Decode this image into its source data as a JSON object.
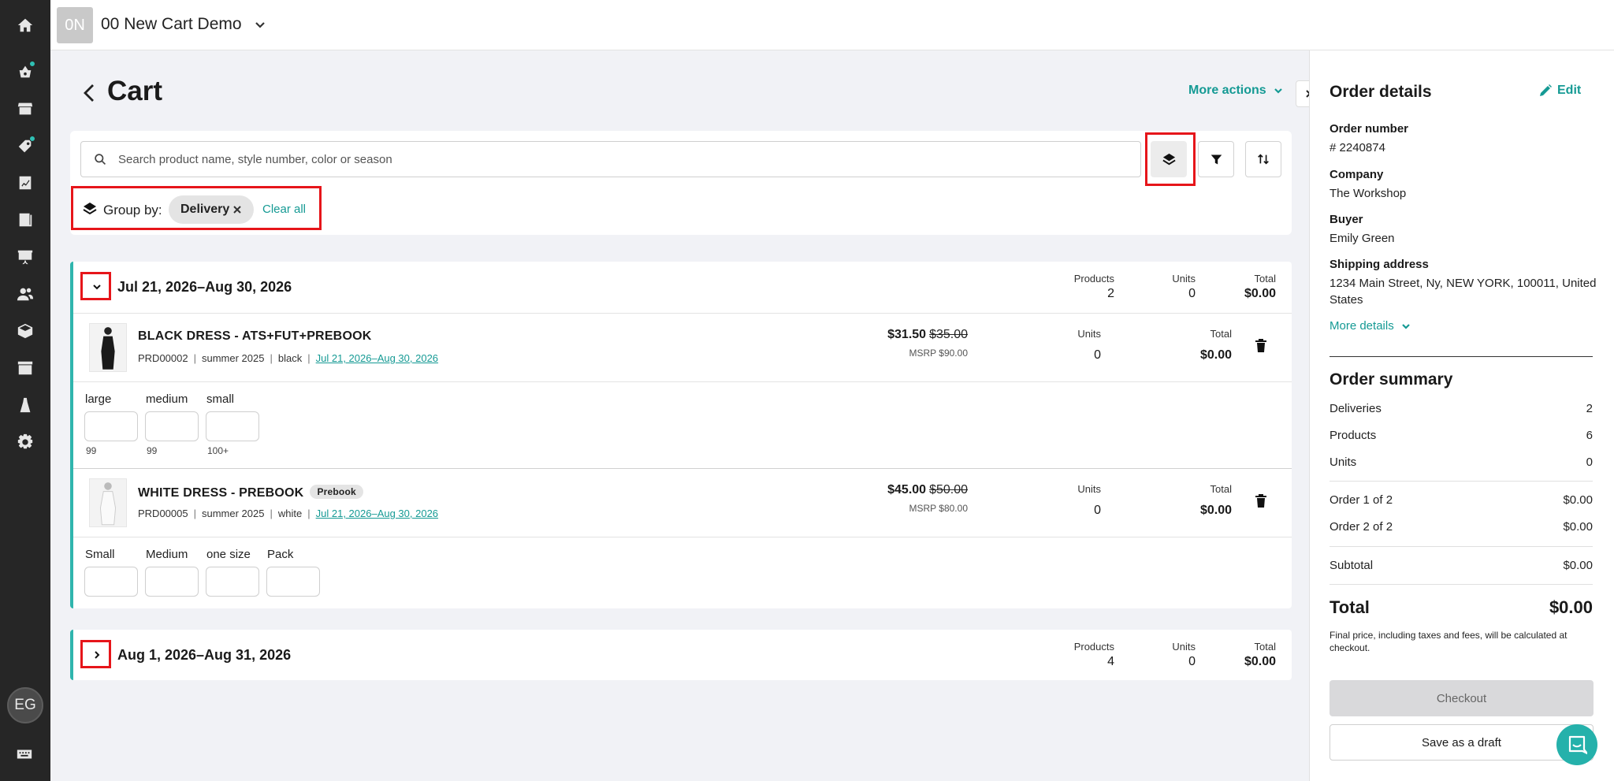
{
  "colors": {
    "accent": "#159a94",
    "sidebar": "#262626",
    "highlight": "#e6151a",
    "group_border": "#2fb5ad"
  },
  "sidebar": {
    "icons": [
      "home-icon",
      "basket-icon",
      "storefront-icon",
      "tag-icon",
      "analytics-icon",
      "catalog-icon",
      "presentation-icon",
      "users-icon",
      "box-icon",
      "shop-icon",
      "brand-icon",
      "gear-icon"
    ],
    "avatar": "EG",
    "bottom_icon": "keyboard-icon"
  },
  "topbar": {
    "workspace_badge": "0N",
    "workspace_name": "00 New Cart Demo"
  },
  "page": {
    "title": "Cart",
    "more_actions": "More actions"
  },
  "toolbar": {
    "search_placeholder": "Search product name, style number, color or season",
    "group_by_label": "Group by:",
    "group_by_chip": "Delivery",
    "clear_all": "Clear all"
  },
  "groups": [
    {
      "title": "Jul 21, 2026–Aug 30, 2026",
      "expanded": true,
      "stats": {
        "products_label": "Products",
        "products": "2",
        "units_label": "Units",
        "units": "0",
        "total_label": "Total",
        "total": "$0.00"
      },
      "products": [
        {
          "name": "BLACK DRESS - ATS+FUT+PREBOOK",
          "code": "PRD00002",
          "season": "summer 2025",
          "color": "black",
          "delivery": "Jul 21, 2026–Aug 30, 2026",
          "price": "$31.50",
          "old_price": "$35.00",
          "msrp": "MSRP $90.00",
          "units_label": "Units",
          "units": "0",
          "total_label": "Total",
          "total": "$0.00",
          "sizes": [
            {
              "label": "large",
              "stock": "99"
            },
            {
              "label": "medium",
              "stock": "99"
            },
            {
              "label": "small",
              "stock": "100+"
            }
          ]
        },
        {
          "name": "WHITE DRESS - PREBOOK",
          "badge": "Prebook",
          "code": "PRD00005",
          "season": "summer 2025",
          "color": "white",
          "delivery": "Jul 21, 2026–Aug 30, 2026",
          "price": "$45.00",
          "old_price": "$50.00",
          "msrp": "MSRP $80.00",
          "units_label": "Units",
          "units": "0",
          "total_label": "Total",
          "total": "$0.00",
          "sizes": [
            {
              "label": "Small"
            },
            {
              "label": "Medium"
            },
            {
              "label": "one size"
            },
            {
              "label": "Pack"
            }
          ]
        }
      ]
    },
    {
      "title": "Aug 1, 2026–Aug 31, 2026",
      "expanded": false,
      "stats": {
        "products_label": "Products",
        "products": "4",
        "units_label": "Units",
        "units": "0",
        "total_label": "Total",
        "total": "$0.00"
      }
    }
  ],
  "order_details": {
    "title": "Order details",
    "edit": "Edit",
    "order_number_label": "Order number",
    "order_number": "# 2240874",
    "company_label": "Company",
    "company": "The Workshop",
    "buyer_label": "Buyer",
    "buyer": "Emily Green",
    "shipping_label": "Shipping address",
    "shipping": "1234 Main Street, Ny, NEW YORK, 100011, United States",
    "more_details": "More details"
  },
  "order_summary": {
    "title": "Order summary",
    "rows": [
      {
        "label": "Deliveries",
        "value": "2"
      },
      {
        "label": "Products",
        "value": "6"
      },
      {
        "label": "Units",
        "value": "0"
      }
    ],
    "orders": [
      {
        "label": "Order 1 of 2",
        "value": "$0.00"
      },
      {
        "label": "Order 2 of 2",
        "value": "$0.00"
      }
    ],
    "subtotal_label": "Subtotal",
    "subtotal": "$0.00",
    "total_label": "Total",
    "total": "$0.00",
    "fineprint": "Final price, including taxes and fees, will be calculated at checkout.",
    "checkout": "Checkout",
    "save_draft": "Save as a draft"
  }
}
